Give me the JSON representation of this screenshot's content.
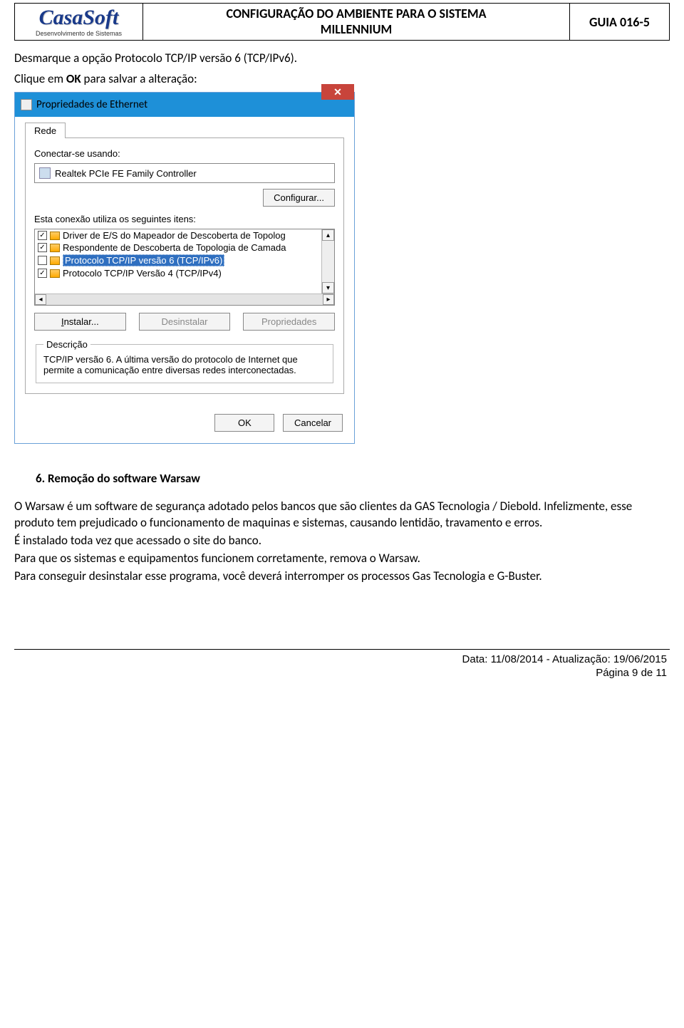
{
  "header": {
    "logo_name": "CasaSoft",
    "logo_sub": "Desenvolvimento de Sistemas",
    "title_line1": "CONFIGURAÇÃO DO AMBIENTE PARA O SISTEMA",
    "title_line2": "MILLENNIUM",
    "guide": "GUIA 016-5"
  },
  "intro": {
    "line1": "Desmarque a opção Protocolo TCP/IP versão 6 (TCP/IPv6).",
    "line2_prefix": "Clique em ",
    "line2_bold": "OK",
    "line2_suffix": " para salvar a alteração:"
  },
  "dialog": {
    "title": "Propriedades de Ethernet",
    "tab": "Rede",
    "connect_label": "Conectar-se usando:",
    "adapter": "Realtek PCIe FE Family Controller",
    "configure_btn": "Configurar...",
    "items_label": "Esta conexão utiliza os seguintes itens:",
    "items": [
      {
        "checked": true,
        "label": "Driver de E/S do Mapeador de Descoberta de Topolog"
      },
      {
        "checked": true,
        "label": "Respondente de Descoberta de Topologia de Camada"
      },
      {
        "checked": false,
        "label": "Protocolo TCP/IP versão 6 (TCP/IPv6)",
        "selected": true
      },
      {
        "checked": true,
        "label": "Protocolo TCP/IP Versão 4 (TCP/IPv4)"
      }
    ],
    "install_btn": "Instalar...",
    "uninstall_btn": "Desinstalar",
    "properties_btn": "Propriedades",
    "desc_legend": "Descrição",
    "desc_text": "TCP/IP versão 6. A última versão do protocolo de Internet que permite a comunicação entre diversas redes interconectadas.",
    "ok_btn": "OK",
    "cancel_btn": "Cancelar"
  },
  "section6": {
    "heading": "6.   Remoção do software Warsaw",
    "p1": "O Warsaw é um software de segurança adotado pelos bancos que são clientes da GAS Tecnologia / Diebold. Infelizmente, esse produto tem prejudicado o funcionamento de maquinas e sistemas, causando lentidão, travamento e erros.",
    "p2": "É instalado toda vez que acessado o site do banco.",
    "p3": "Para que os sistemas e equipamentos funcionem corretamente, remova o Warsaw.",
    "p4": "Para conseguir desinstalar esse programa, você deverá interromper os processos Gas Tecnologia e G-Buster."
  },
  "footer": {
    "line1": "Data: 11/08/2014 - Atualização: 19/06/2015",
    "line2": "Página 9 de 11"
  }
}
